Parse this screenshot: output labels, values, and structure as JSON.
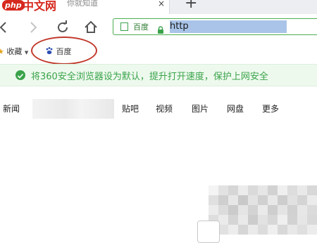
{
  "browser": {
    "tab_title": "一下，你就知道",
    "tab_close": "×",
    "new_tab": "+",
    "watermark": {
      "badge": "php",
      "text": "中文网"
    },
    "address": {
      "site_label": "百度",
      "url": "http"
    },
    "bookmarks": {
      "favorites_label": "收藏",
      "baidu_label": "百度"
    },
    "infobar_text": "将360安全浏览器设为默认，提升打开速度，保护上网安全"
  },
  "baidu": {
    "nav": [
      "新闻",
      "贴吧",
      "视频",
      "图片",
      "网盘",
      "更多"
    ]
  },
  "colors": {
    "accent_green": "#3aa34a",
    "annotation_red": "#c0392b",
    "url_highlight": "#a9c4e8"
  }
}
